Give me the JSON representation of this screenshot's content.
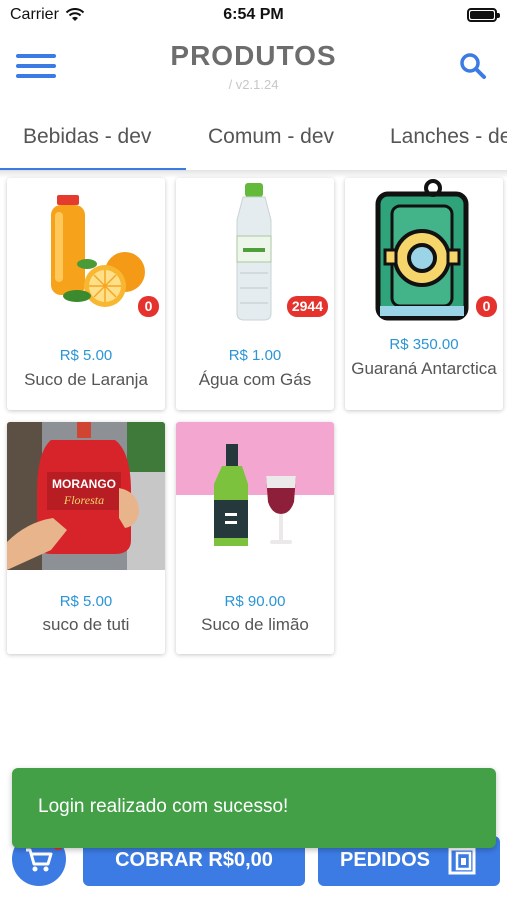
{
  "status_bar": {
    "carrier": "Carrier",
    "time": "6:54 PM"
  },
  "header": {
    "title": "PRODUTOS",
    "version": "/ v2.1.24"
  },
  "tabs": [
    {
      "label": "Bebidas - dev",
      "selected": true
    },
    {
      "label": "Comum - dev",
      "selected": false
    },
    {
      "label": "Lanches - dev",
      "selected": false
    }
  ],
  "products": [
    {
      "price": "R$ 5.00",
      "name": "Suco de Laranja",
      "stock": "0",
      "image": "orange-juice"
    },
    {
      "price": "R$ 1.00",
      "name": "Água com Gás",
      "stock": "2944",
      "image": "water-bottle"
    },
    {
      "price": "R$ 350.00",
      "name": "Guaraná Antarctica",
      "stock": "0",
      "image": "soda-can"
    },
    {
      "price": "R$ 5.00",
      "name": "suco de tuti",
      "image": "strawberry-juice-photo",
      "photo_label": "MORANGO"
    },
    {
      "price": "R$ 90.00",
      "name": "Suco de limão",
      "image": "wine-bottle-glass"
    }
  ],
  "toast": {
    "message": "Login realizado com sucesso!"
  },
  "bottom_bar": {
    "charge_label": "COBRAR R$0,00",
    "orders_label": "PEDIDOS"
  },
  "colors": {
    "accent": "#3b7be3",
    "price": "#2b95d6",
    "badge": "#e5322d",
    "toast": "#43a047"
  }
}
